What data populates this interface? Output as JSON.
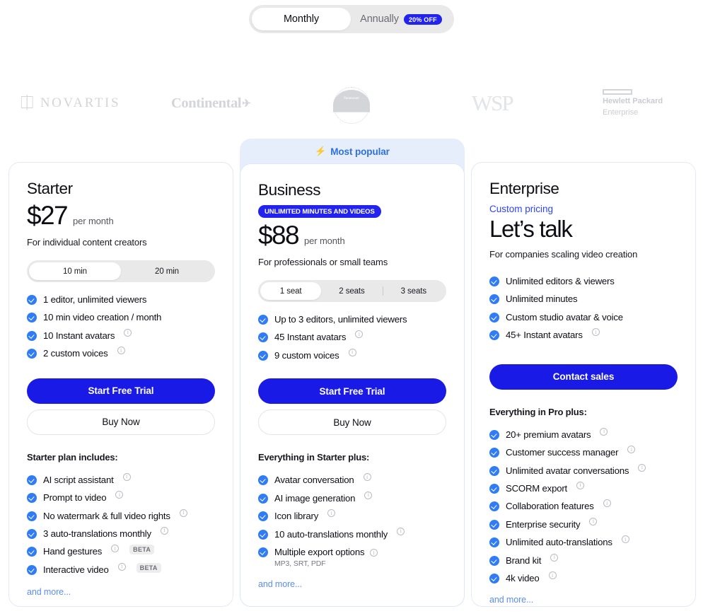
{
  "billing": {
    "monthly_label": "Monthly",
    "annual_label": "Annually",
    "annual_badge": "20% OFF"
  },
  "logos": [
    {
      "name": "novartis",
      "text": "NOVARTIS"
    },
    {
      "name": "continental",
      "text": "Continental"
    },
    {
      "name": "paramount",
      "text": "Paramount"
    },
    {
      "name": "wsp",
      "text": "WSP"
    },
    {
      "name": "hewlett-packard-enterprise",
      "line1": "Hewlett Packard",
      "line2": "Enterprise"
    }
  ],
  "colors": {
    "accent_blue": "#1a1ae6",
    "badge_blue": "#2323f0",
    "check_blue": "#2f7cf6",
    "link_blue": "#5b8def",
    "popular_bg": "#e6eefb",
    "toggle_bg": "#e9e9ea"
  },
  "popular_banner": {
    "label": "Most popular",
    "icon": "bolt-icon"
  },
  "plans": {
    "starter": {
      "name": "Starter",
      "price": "$27",
      "price_unit": "per month",
      "subtitle": "For individual content creators",
      "toggle": {
        "options": [
          "10 min",
          "20 min"
        ],
        "selected": "10 min"
      },
      "features": [
        {
          "text": "1 editor, unlimited viewers",
          "info": false
        },
        {
          "text": "10 min video creation / month",
          "info": false
        },
        {
          "text": "10 Instant avatars",
          "info": true
        },
        {
          "text": "2 custom voices",
          "info": true
        }
      ],
      "primary_cta": "Start Free Trial",
      "secondary_cta": "Buy Now",
      "includes_title": "Starter plan includes:",
      "includes": [
        {
          "text": "AI script assistant",
          "info": true
        },
        {
          "text": "Prompt to video",
          "info": true
        },
        {
          "text": "No watermark & full video rights",
          "info": true
        },
        {
          "text": "3 auto-translations monthly",
          "info": true
        },
        {
          "text": "Hand gestures",
          "info": true,
          "badge": "BETA"
        },
        {
          "text": "Interactive video",
          "info": true,
          "badge": "BETA"
        }
      ],
      "and_more": "and more..."
    },
    "business": {
      "name": "Business",
      "badge": "UNLIMITED MINUTES AND VIDEOS",
      "price": "$88",
      "price_unit": "per month",
      "subtitle": "For professionals or small teams",
      "toggle": {
        "options": [
          "1 seat",
          "2 seats",
          "3 seats"
        ],
        "selected": "1 seat"
      },
      "features": [
        {
          "text": "Up to 3 editors, unlimited viewers",
          "info": false
        },
        {
          "text": "45 Instant avatars",
          "info": true
        },
        {
          "text": "9 custom voices",
          "info": true
        }
      ],
      "primary_cta": "Start Free Trial",
      "secondary_cta": "Buy Now",
      "includes_title": "Everything in Starter plus:",
      "includes": [
        {
          "text": "Avatar conversation",
          "info": true
        },
        {
          "text": "AI image generation",
          "info": true
        },
        {
          "text": "Icon library",
          "info": true
        },
        {
          "text": "10 auto-translations monthly",
          "info": true
        },
        {
          "text": "Multiple export options",
          "info": true,
          "note": "MP3, SRT, PDF"
        }
      ],
      "and_more": "and more..."
    },
    "enterprise": {
      "name": "Enterprise",
      "custom_pricing": "Custom pricing",
      "headline": "Let’s talk",
      "subtitle": "For companies scaling video creation",
      "features": [
        {
          "text": "Unlimited editors & viewers",
          "info": false
        },
        {
          "text": "Unlimited minutes",
          "info": false
        },
        {
          "text": "Custom studio avatar & voice",
          "info": false
        },
        {
          "text": "45+ Instant avatars",
          "info": true
        }
      ],
      "primary_cta": "Contact sales",
      "includes_title": "Everything in Pro plus:",
      "includes": [
        {
          "text": "20+ premium avatars",
          "info": true
        },
        {
          "text": "Customer success manager",
          "info": true
        },
        {
          "text": "Unlimited avatar conversations",
          "info": true
        },
        {
          "text": "SCORM export",
          "info": true
        },
        {
          "text": "Collaboration features",
          "info": true
        },
        {
          "text": "Enterprise security",
          "info": true
        },
        {
          "text": "Unlimited auto-translations",
          "info": true
        },
        {
          "text": "Brand kit",
          "info": true
        },
        {
          "text": "4k video",
          "info": true
        }
      ],
      "and_more": "and more..."
    }
  }
}
